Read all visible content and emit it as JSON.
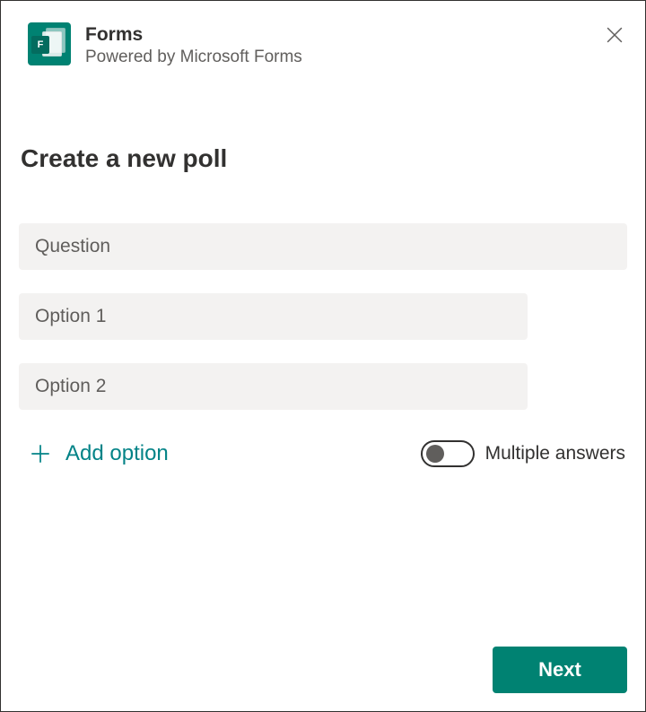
{
  "header": {
    "app_title": "Forms",
    "app_subtitle": "Powered by Microsoft Forms",
    "icon_badge": "F"
  },
  "page": {
    "title": "Create a new poll"
  },
  "form": {
    "question_placeholder": "Question",
    "question_value": "",
    "options": [
      {
        "placeholder": "Option 1",
        "value": ""
      },
      {
        "placeholder": "Option 2",
        "value": ""
      }
    ],
    "add_option_label": "Add option",
    "multiple_answers": {
      "label": "Multiple answers",
      "enabled": false
    }
  },
  "footer": {
    "next_label": "Next"
  },
  "colors": {
    "brand_teal": "#008272",
    "accent_teal": "#038387",
    "surface_field": "#f3f2f1",
    "text_primary": "#323130",
    "text_secondary": "#605e5c"
  }
}
